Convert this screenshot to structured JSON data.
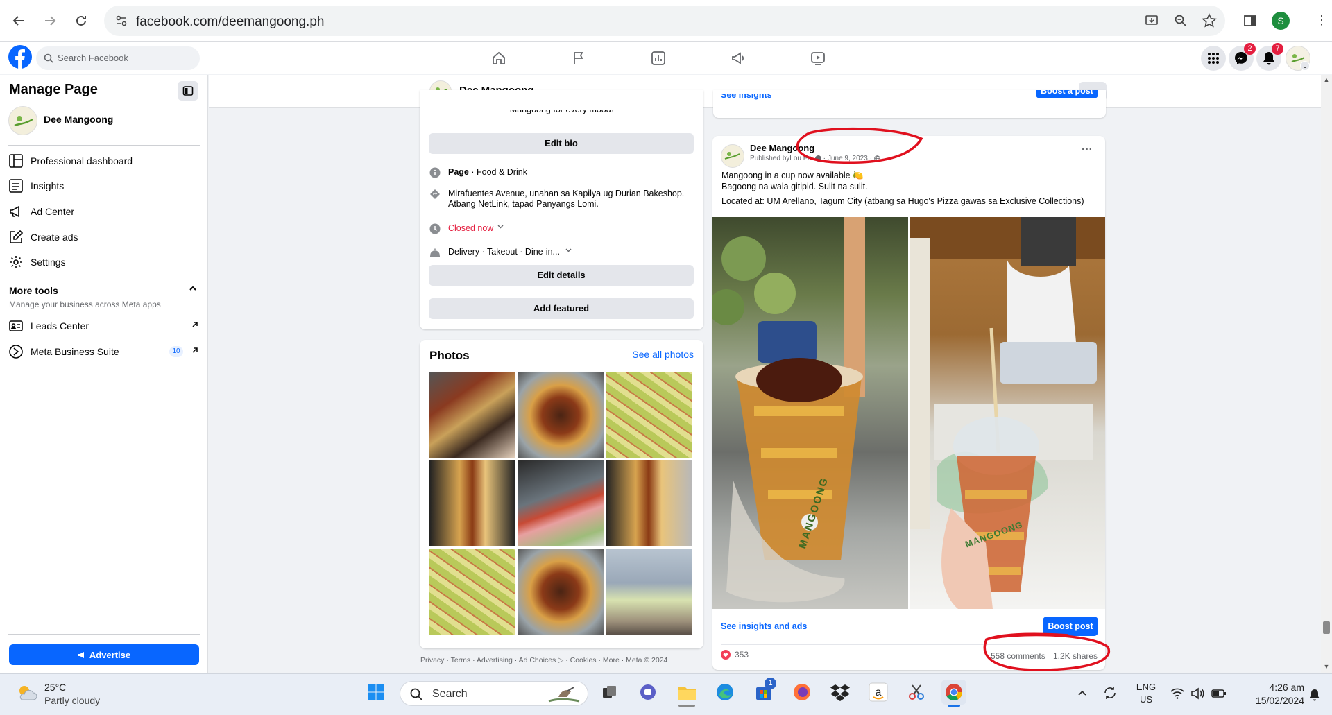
{
  "browser": {
    "url": "facebook.com/deemangoong.ph",
    "profile_letter": "S"
  },
  "fb": {
    "search_placeholder": "Search Facebook",
    "messenger_badge": "2",
    "notif_badge": "7"
  },
  "sidebar": {
    "title": "Manage Page",
    "page_name": "Dee Mangoong",
    "items": [
      {
        "label": "Professional dashboard",
        "icon": "dashboard-icon"
      },
      {
        "label": "Insights",
        "icon": "insights-icon"
      },
      {
        "label": "Ad Center",
        "icon": "megaphone-icon"
      },
      {
        "label": "Create ads",
        "icon": "pencil-icon"
      },
      {
        "label": "Settings",
        "icon": "gear-icon"
      }
    ],
    "more_tools": {
      "title": "More tools",
      "subtitle": "Manage your business across Meta apps"
    },
    "tools": [
      {
        "label": "Leads Center",
        "icon": "leads-icon"
      },
      {
        "label": "Meta Business Suite",
        "badge": "10",
        "icon": "meta-suite-icon"
      }
    ],
    "advertise": "Advertise"
  },
  "page_header": {
    "name": "Dee Mangoong",
    "more": "..."
  },
  "intro": {
    "bio_partial": "Mangoong for every mood!",
    "edit_bio": "Edit bio",
    "category_bold": "Page",
    "category_rest": " · Food & Drink",
    "address": "Mirafuentes Avenue, unahan sa Kapilya ug Durian Bakeshop. Atbang NetLink, tapad Panyangs Lomi.",
    "hours": "Closed now",
    "services": "Delivery · Takeout · Dine-in...",
    "edit_details": "Edit details",
    "add_featured": "Add featured"
  },
  "photos": {
    "title": "Photos",
    "see_all": "See all photos"
  },
  "footer": "Privacy · Terms · Advertising · Ad Choices ▷ · Cookies · More · Meta © 2024",
  "prev_post": {
    "see_insights": "See insights",
    "boost": "Boost a post"
  },
  "post": {
    "author": "Dee Mangoong",
    "published_prefix": "Published by ",
    "publisher": "Lou Ful",
    "date": "June 9, 2023",
    "line1": "Mangoong in a cup now available 🍋",
    "line2": "Bagoong na wala gitipid. Sulit na sulit.",
    "line3": "Located at: UM Arellano, Tagum City (atbang sa Hugo's Pizza gawas sa Exclusive Collections)",
    "see_insights_ads": "See insights and ads",
    "boost_post": "Boost post",
    "reactions": "353",
    "comments": "558 comments",
    "shares": "1.2K shares",
    "cup_text": "MANGOONG",
    "cup_text2": "MANGOONG"
  },
  "taskbar": {
    "temp": "25°C",
    "weather": "Partly cloudy",
    "search": "Search",
    "store_badge": "1",
    "lang1": "ENG",
    "lang2": "US",
    "time": "4:26 am",
    "date": "15/02/2024"
  },
  "colors": {
    "fb_blue": "#0866ff",
    "annotation_red": "#e0101e",
    "closed_red": "#e41e3f"
  }
}
